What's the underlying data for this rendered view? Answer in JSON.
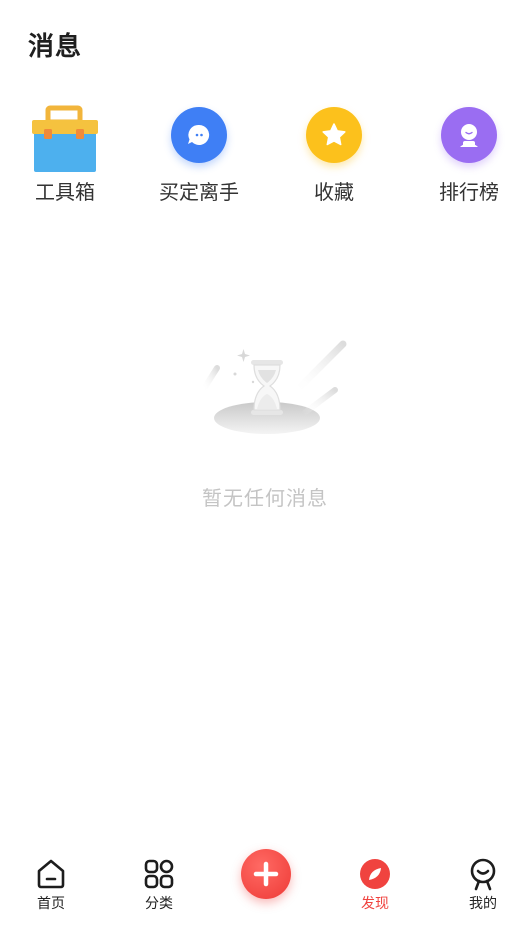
{
  "header": {
    "title": "消息"
  },
  "quick_actions": [
    {
      "label": "工具箱",
      "icon": "toolbox-icon"
    },
    {
      "label": "买定离手",
      "icon": "chat-bubble-icon",
      "color": "#3f7ff5"
    },
    {
      "label": "收藏",
      "icon": "star-icon",
      "color": "#fcc11c"
    },
    {
      "label": "排行榜",
      "icon": "person-icon",
      "color": "#9a6df2"
    }
  ],
  "empty_state": {
    "message": "暂无任何消息",
    "icon": "hourglass-icon"
  },
  "tabbar": {
    "items": [
      {
        "label": "首页",
        "icon": "home-icon"
      },
      {
        "label": "分类",
        "icon": "grid-icon"
      },
      {
        "label": "发现",
        "icon": "discover-icon",
        "active": true
      },
      {
        "label": "我的",
        "icon": "profile-icon"
      }
    ],
    "center_button": {
      "icon": "plus-icon"
    }
  },
  "colors": {
    "accent": "#f0433f",
    "muted_text": "#c4c4c4"
  }
}
